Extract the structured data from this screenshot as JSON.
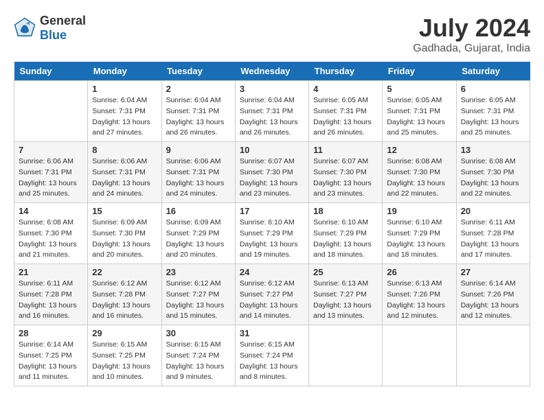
{
  "header": {
    "logo_general": "General",
    "logo_blue": "Blue",
    "month_year": "July 2024",
    "location": "Gadhada, Gujarat, India"
  },
  "days_of_week": [
    "Sunday",
    "Monday",
    "Tuesday",
    "Wednesday",
    "Thursday",
    "Friday",
    "Saturday"
  ],
  "weeks": [
    [
      {
        "date": "",
        "sunrise": "",
        "sunset": "",
        "daylight": ""
      },
      {
        "date": "1",
        "sunrise": "Sunrise: 6:04 AM",
        "sunset": "Sunset: 7:31 PM",
        "daylight": "Daylight: 13 hours and 27 minutes."
      },
      {
        "date": "2",
        "sunrise": "Sunrise: 6:04 AM",
        "sunset": "Sunset: 7:31 PM",
        "daylight": "Daylight: 13 hours and 26 minutes."
      },
      {
        "date": "3",
        "sunrise": "Sunrise: 6:04 AM",
        "sunset": "Sunset: 7:31 PM",
        "daylight": "Daylight: 13 hours and 26 minutes."
      },
      {
        "date": "4",
        "sunrise": "Sunrise: 6:05 AM",
        "sunset": "Sunset: 7:31 PM",
        "daylight": "Daylight: 13 hours and 26 minutes."
      },
      {
        "date": "5",
        "sunrise": "Sunrise: 6:05 AM",
        "sunset": "Sunset: 7:31 PM",
        "daylight": "Daylight: 13 hours and 25 minutes."
      },
      {
        "date": "6",
        "sunrise": "Sunrise: 6:05 AM",
        "sunset": "Sunset: 7:31 PM",
        "daylight": "Daylight: 13 hours and 25 minutes."
      }
    ],
    [
      {
        "date": "7",
        "sunrise": "Sunrise: 6:06 AM",
        "sunset": "Sunset: 7:31 PM",
        "daylight": "Daylight: 13 hours and 25 minutes."
      },
      {
        "date": "8",
        "sunrise": "Sunrise: 6:06 AM",
        "sunset": "Sunset: 7:31 PM",
        "daylight": "Daylight: 13 hours and 24 minutes."
      },
      {
        "date": "9",
        "sunrise": "Sunrise: 6:06 AM",
        "sunset": "Sunset: 7:31 PM",
        "daylight": "Daylight: 13 hours and 24 minutes."
      },
      {
        "date": "10",
        "sunrise": "Sunrise: 6:07 AM",
        "sunset": "Sunset: 7:30 PM",
        "daylight": "Daylight: 13 hours and 23 minutes."
      },
      {
        "date": "11",
        "sunrise": "Sunrise: 6:07 AM",
        "sunset": "Sunset: 7:30 PM",
        "daylight": "Daylight: 13 hours and 23 minutes."
      },
      {
        "date": "12",
        "sunrise": "Sunrise: 6:08 AM",
        "sunset": "Sunset: 7:30 PM",
        "daylight": "Daylight: 13 hours and 22 minutes."
      },
      {
        "date": "13",
        "sunrise": "Sunrise: 6:08 AM",
        "sunset": "Sunset: 7:30 PM",
        "daylight": "Daylight: 13 hours and 22 minutes."
      }
    ],
    [
      {
        "date": "14",
        "sunrise": "Sunrise: 6:08 AM",
        "sunset": "Sunset: 7:30 PM",
        "daylight": "Daylight: 13 hours and 21 minutes."
      },
      {
        "date": "15",
        "sunrise": "Sunrise: 6:09 AM",
        "sunset": "Sunset: 7:30 PM",
        "daylight": "Daylight: 13 hours and 20 minutes."
      },
      {
        "date": "16",
        "sunrise": "Sunrise: 6:09 AM",
        "sunset": "Sunset: 7:29 PM",
        "daylight": "Daylight: 13 hours and 20 minutes."
      },
      {
        "date": "17",
        "sunrise": "Sunrise: 6:10 AM",
        "sunset": "Sunset: 7:29 PM",
        "daylight": "Daylight: 13 hours and 19 minutes."
      },
      {
        "date": "18",
        "sunrise": "Sunrise: 6:10 AM",
        "sunset": "Sunset: 7:29 PM",
        "daylight": "Daylight: 13 hours and 18 minutes."
      },
      {
        "date": "19",
        "sunrise": "Sunrise: 6:10 AM",
        "sunset": "Sunset: 7:29 PM",
        "daylight": "Daylight: 13 hours and 18 minutes."
      },
      {
        "date": "20",
        "sunrise": "Sunrise: 6:11 AM",
        "sunset": "Sunset: 7:28 PM",
        "daylight": "Daylight: 13 hours and 17 minutes."
      }
    ],
    [
      {
        "date": "21",
        "sunrise": "Sunrise: 6:11 AM",
        "sunset": "Sunset: 7:28 PM",
        "daylight": "Daylight: 13 hours and 16 minutes."
      },
      {
        "date": "22",
        "sunrise": "Sunrise: 6:12 AM",
        "sunset": "Sunset: 7:28 PM",
        "daylight": "Daylight: 13 hours and 16 minutes."
      },
      {
        "date": "23",
        "sunrise": "Sunrise: 6:12 AM",
        "sunset": "Sunset: 7:27 PM",
        "daylight": "Daylight: 13 hours and 15 minutes."
      },
      {
        "date": "24",
        "sunrise": "Sunrise: 6:12 AM",
        "sunset": "Sunset: 7:27 PM",
        "daylight": "Daylight: 13 hours and 14 minutes."
      },
      {
        "date": "25",
        "sunrise": "Sunrise: 6:13 AM",
        "sunset": "Sunset: 7:27 PM",
        "daylight": "Daylight: 13 hours and 13 minutes."
      },
      {
        "date": "26",
        "sunrise": "Sunrise: 6:13 AM",
        "sunset": "Sunset: 7:26 PM",
        "daylight": "Daylight: 13 hours and 12 minutes."
      },
      {
        "date": "27",
        "sunrise": "Sunrise: 6:14 AM",
        "sunset": "Sunset: 7:26 PM",
        "daylight": "Daylight: 13 hours and 12 minutes."
      }
    ],
    [
      {
        "date": "28",
        "sunrise": "Sunrise: 6:14 AM",
        "sunset": "Sunset: 7:25 PM",
        "daylight": "Daylight: 13 hours and 11 minutes."
      },
      {
        "date": "29",
        "sunrise": "Sunrise: 6:15 AM",
        "sunset": "Sunset: 7:25 PM",
        "daylight": "Daylight: 13 hours and 10 minutes."
      },
      {
        "date": "30",
        "sunrise": "Sunrise: 6:15 AM",
        "sunset": "Sunset: 7:24 PM",
        "daylight": "Daylight: 13 hours and 9 minutes."
      },
      {
        "date": "31",
        "sunrise": "Sunrise: 6:15 AM",
        "sunset": "Sunset: 7:24 PM",
        "daylight": "Daylight: 13 hours and 8 minutes."
      },
      {
        "date": "",
        "sunrise": "",
        "sunset": "",
        "daylight": ""
      },
      {
        "date": "",
        "sunrise": "",
        "sunset": "",
        "daylight": ""
      },
      {
        "date": "",
        "sunrise": "",
        "sunset": "",
        "daylight": ""
      }
    ]
  ]
}
